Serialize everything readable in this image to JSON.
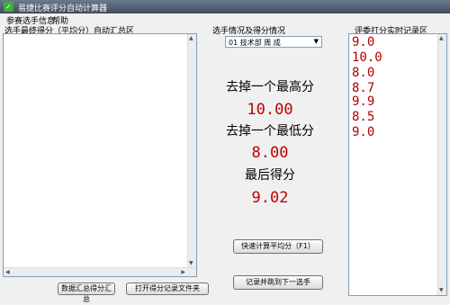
{
  "window": {
    "title": "易捷比赛评分自动计算器"
  },
  "menu": {
    "items": [
      "参赛选手信息",
      "帮助"
    ]
  },
  "left_panel": {
    "label": "选手最终得分（平均分）自动汇总区",
    "btn_summary": "数据汇总得分汇总",
    "btn_open_folder": "打开得分记录文件夹"
  },
  "middle_panel": {
    "label": "选手情况及得分情况",
    "selected_contestant": "01 技术部 周 成",
    "remove_highest_label": "去掉一个最高分",
    "remove_highest_value": "10.00",
    "remove_lowest_label": "去掉一个最低分",
    "remove_lowest_value": "8.00",
    "final_label": "最后得分",
    "final_value": "9.02",
    "btn_quick_avg": "快速计算平均分（F1）",
    "btn_record_next": "记录并跳到下一选手"
  },
  "right_panel": {
    "label": "评委打分实时记录区",
    "scores": [
      "9.0",
      "10.0",
      "8.0",
      "8.7",
      "9.9",
      "8.5",
      "9.0"
    ]
  },
  "colors": {
    "score": "#c00000",
    "title_bar": "#4a5868"
  }
}
